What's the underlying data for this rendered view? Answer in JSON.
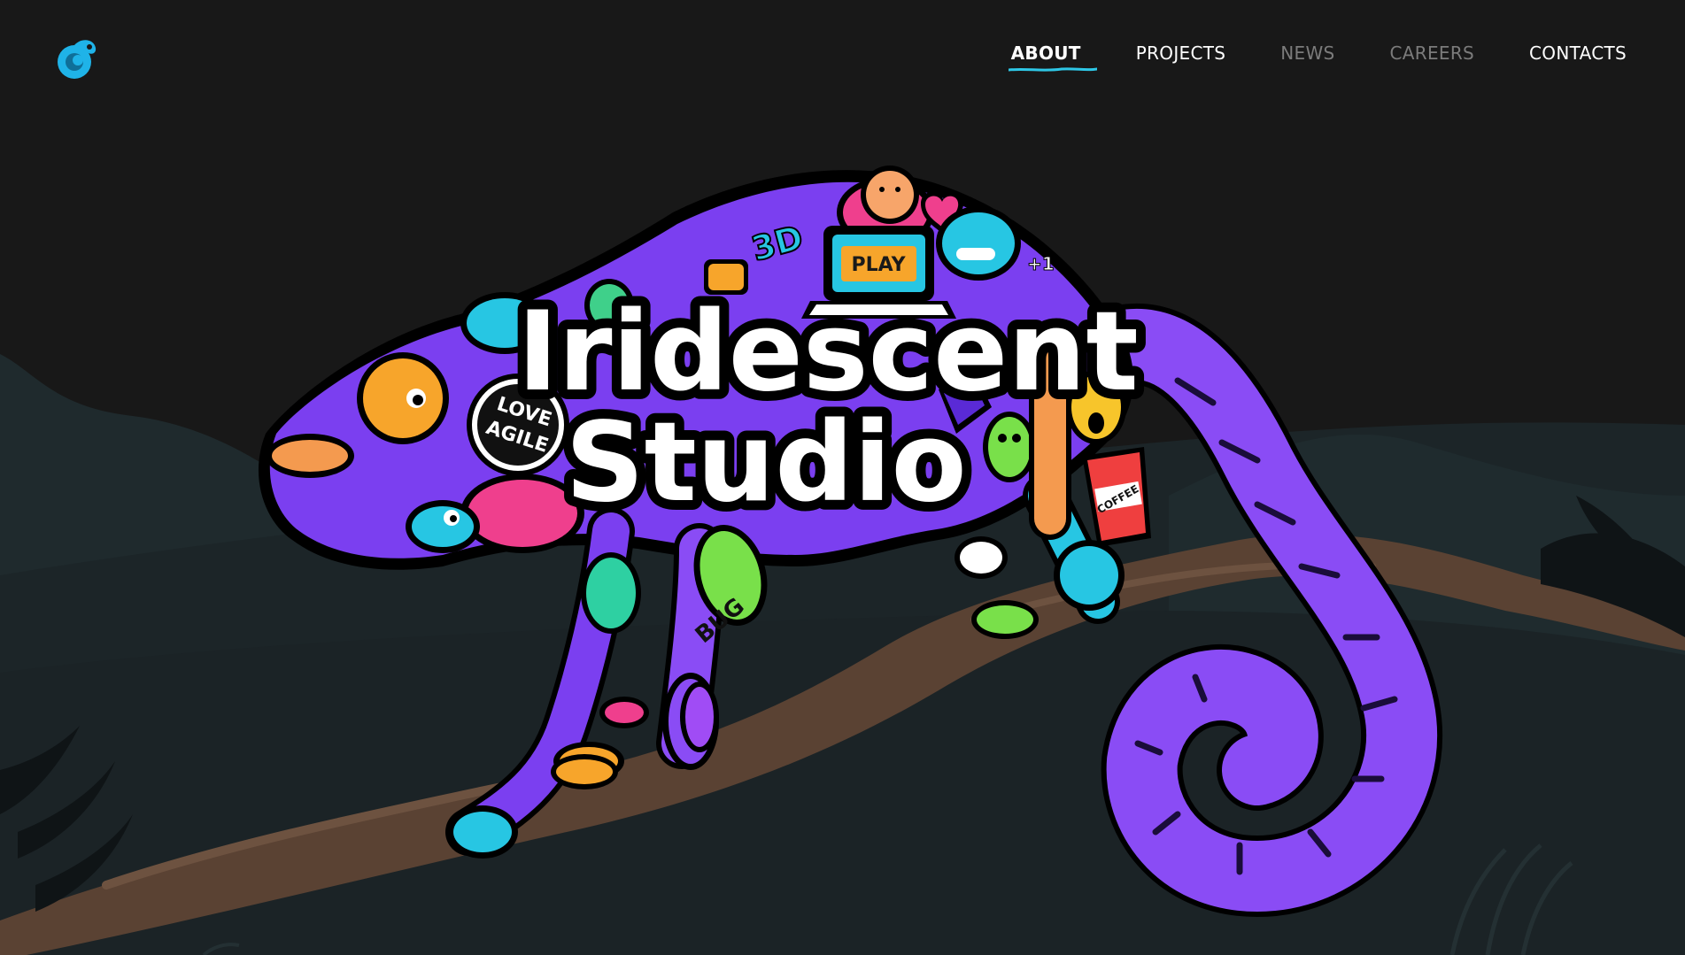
{
  "site": {
    "logo_icon": "chameleon-logo-icon",
    "logo_color": "#1fb3e8"
  },
  "nav": {
    "items": [
      {
        "label": "ABOUT",
        "active": true
      },
      {
        "label": "PROJECTS",
        "active": false
      },
      {
        "label": "NEWS",
        "active": false
      },
      {
        "label": "CAREERS",
        "active": false
      },
      {
        "label": "CONTACTS",
        "active": false
      }
    ],
    "underline_color": "#2ec7e6"
  },
  "hero": {
    "title_line1": "Iridescent",
    "title_line2": "Studio",
    "illustration": "chameleon-on-branch-illustration",
    "stickers": {
      "play": "PLAY",
      "three_d": "3D",
      "love": "LOVE",
      "agile": "AGILE",
      "bug": "BUG",
      "coffee": "COFFEE",
      "plus_one": "+1"
    },
    "colors": {
      "body": "#7b3ff0",
      "tail": "#8a4cf5",
      "cyan": "#27c6e3",
      "pink": "#ef3f8d",
      "orange": "#f7a52b",
      "green": "#79e04a",
      "branch": "#5a4233"
    }
  }
}
